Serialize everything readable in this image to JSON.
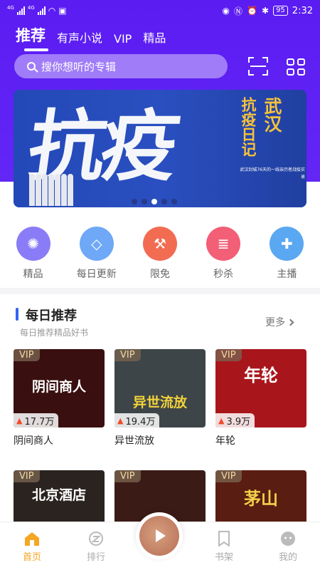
{
  "status_bar": {
    "sig_label_1": "4G",
    "sig_label_2": "4G",
    "battery": "95",
    "time": "2:32"
  },
  "tabs": [
    {
      "label": "推荐",
      "active": true
    },
    {
      "label": "有声小说",
      "active": false
    },
    {
      "label": "VIP",
      "active": false
    },
    {
      "label": "精品",
      "active": false
    }
  ],
  "search": {
    "placeholder": "搜你想听的专辑"
  },
  "banner": {
    "big_text": "抗疫",
    "vertical_title_1": "武汉",
    "vertical_title_2": "抗疫日记",
    "subtitle": "武汉封城76天的一线亲历者战疫实录",
    "page_count": 5,
    "active_page": 3
  },
  "categories": [
    {
      "label": "精品",
      "icon": "flame-icon",
      "color": "#8a7cf6"
    },
    {
      "label": "每日更新",
      "icon": "diamond-icon",
      "color": "#6ea8f7"
    },
    {
      "label": "限免",
      "icon": "axe-icon",
      "color": "#f26c52"
    },
    {
      "label": "秒杀",
      "icon": "coins-icon",
      "color": "#f25f76"
    },
    {
      "label": "主播",
      "icon": "puzzle-icon",
      "color": "#5aa7f2"
    }
  ],
  "section": {
    "title": "每日推荐",
    "subtitle": "每日推荐精品好书",
    "more": "更多"
  },
  "books": [
    {
      "title": "阴间商人",
      "vip": "VIP",
      "plays": "17.7万",
      "cover_text": "阴间商人",
      "cover_color": "#3a0f0f"
    },
    {
      "title": "异世流放",
      "vip": "VIP",
      "plays": "19.4万",
      "cover_text": "异世流放",
      "cover_color": "#3d4548"
    },
    {
      "title": "年轮",
      "vip": "VIP",
      "plays": "3.9万",
      "cover_text": "年轮",
      "cover_color": "#a8161b"
    },
    {
      "title": "",
      "vip": "VIP",
      "plays": "",
      "cover_text": "北京酒店",
      "cover_color": "#2a2320"
    },
    {
      "title": "",
      "vip": "VIP",
      "plays": "",
      "cover_text": "",
      "cover_color": "#3b1b16"
    },
    {
      "title": "",
      "vip": "VIP",
      "plays": "",
      "cover_text": "茅山",
      "cover_color": "#5a1d12"
    }
  ],
  "nav": [
    {
      "label": "首页",
      "icon": "home-icon",
      "active": true
    },
    {
      "label": "排行",
      "icon": "ranking-icon",
      "active": false
    },
    {
      "label": "书架",
      "icon": "bookmark-icon",
      "active": false
    },
    {
      "label": "我的",
      "icon": "profile-icon",
      "active": false
    }
  ],
  "accent": "#5b1cf2",
  "nav_active_color": "#f5a623"
}
